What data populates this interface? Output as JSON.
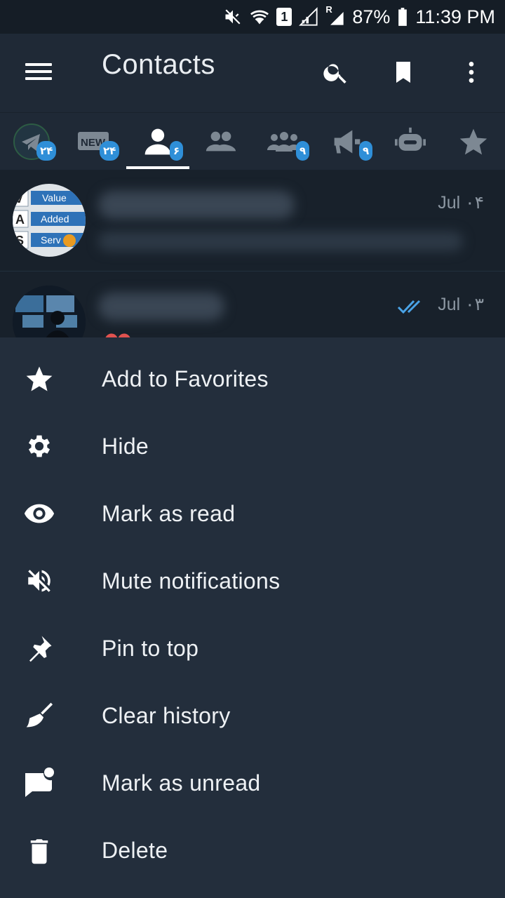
{
  "status_bar": {
    "battery_percent": "87%",
    "time": "11:39 PM",
    "sim_badge": "1",
    "roaming_badge": "R",
    "icons": [
      "mute-icon",
      "wifi-icon",
      "sim-icon",
      "signal-icon",
      "signal-roaming-icon",
      "battery-icon"
    ]
  },
  "header": {
    "title": "Contacts",
    "actions": [
      "search-icon",
      "bookmark-icon",
      "more-vert-icon"
    ]
  },
  "tabs": [
    {
      "name": "all-chats",
      "icon": "telegram-icon",
      "badge": "۲۴"
    },
    {
      "name": "unread",
      "icon": "new-icon",
      "badge": "۲۴"
    },
    {
      "name": "contacts",
      "icon": "person-icon",
      "badge": "۶",
      "active": true
    },
    {
      "name": "groups",
      "icon": "group-icon",
      "badge": ""
    },
    {
      "name": "supergroups",
      "icon": "supergroup-icon",
      "badge": "۹"
    },
    {
      "name": "channels",
      "icon": "megaphone-icon",
      "badge": "۹"
    },
    {
      "name": "bots",
      "icon": "bot-icon",
      "badge": ""
    },
    {
      "name": "favorites",
      "icon": "star-icon",
      "badge": ""
    }
  ],
  "chats": [
    {
      "avatar_lines": [
        "V",
        "A",
        "S",
        "Value",
        "Added",
        "Serv"
      ],
      "date": "Jul ۰۴",
      "read": false
    },
    {
      "date": "Jul ۰۳",
      "read": true
    }
  ],
  "sheet": {
    "items": [
      {
        "label": "Add to Favorites",
        "icon": "star-icon"
      },
      {
        "label": "Hide",
        "icon": "gear-icon"
      },
      {
        "label": "Mark as read",
        "icon": "eye-icon"
      },
      {
        "label": "Mute notifications",
        "icon": "mute-icon"
      },
      {
        "label": "Pin to top",
        "icon": "pin-icon"
      },
      {
        "label": "Clear history",
        "icon": "broom-icon"
      },
      {
        "label": "Mark as unread",
        "icon": "chat-unread-icon"
      },
      {
        "label": "Delete",
        "icon": "trash-icon"
      }
    ]
  },
  "colors": {
    "background": "#1d2733",
    "sheet": "#232e3c",
    "accent": "#2f8fd8",
    "status_bar": "#151d26"
  }
}
